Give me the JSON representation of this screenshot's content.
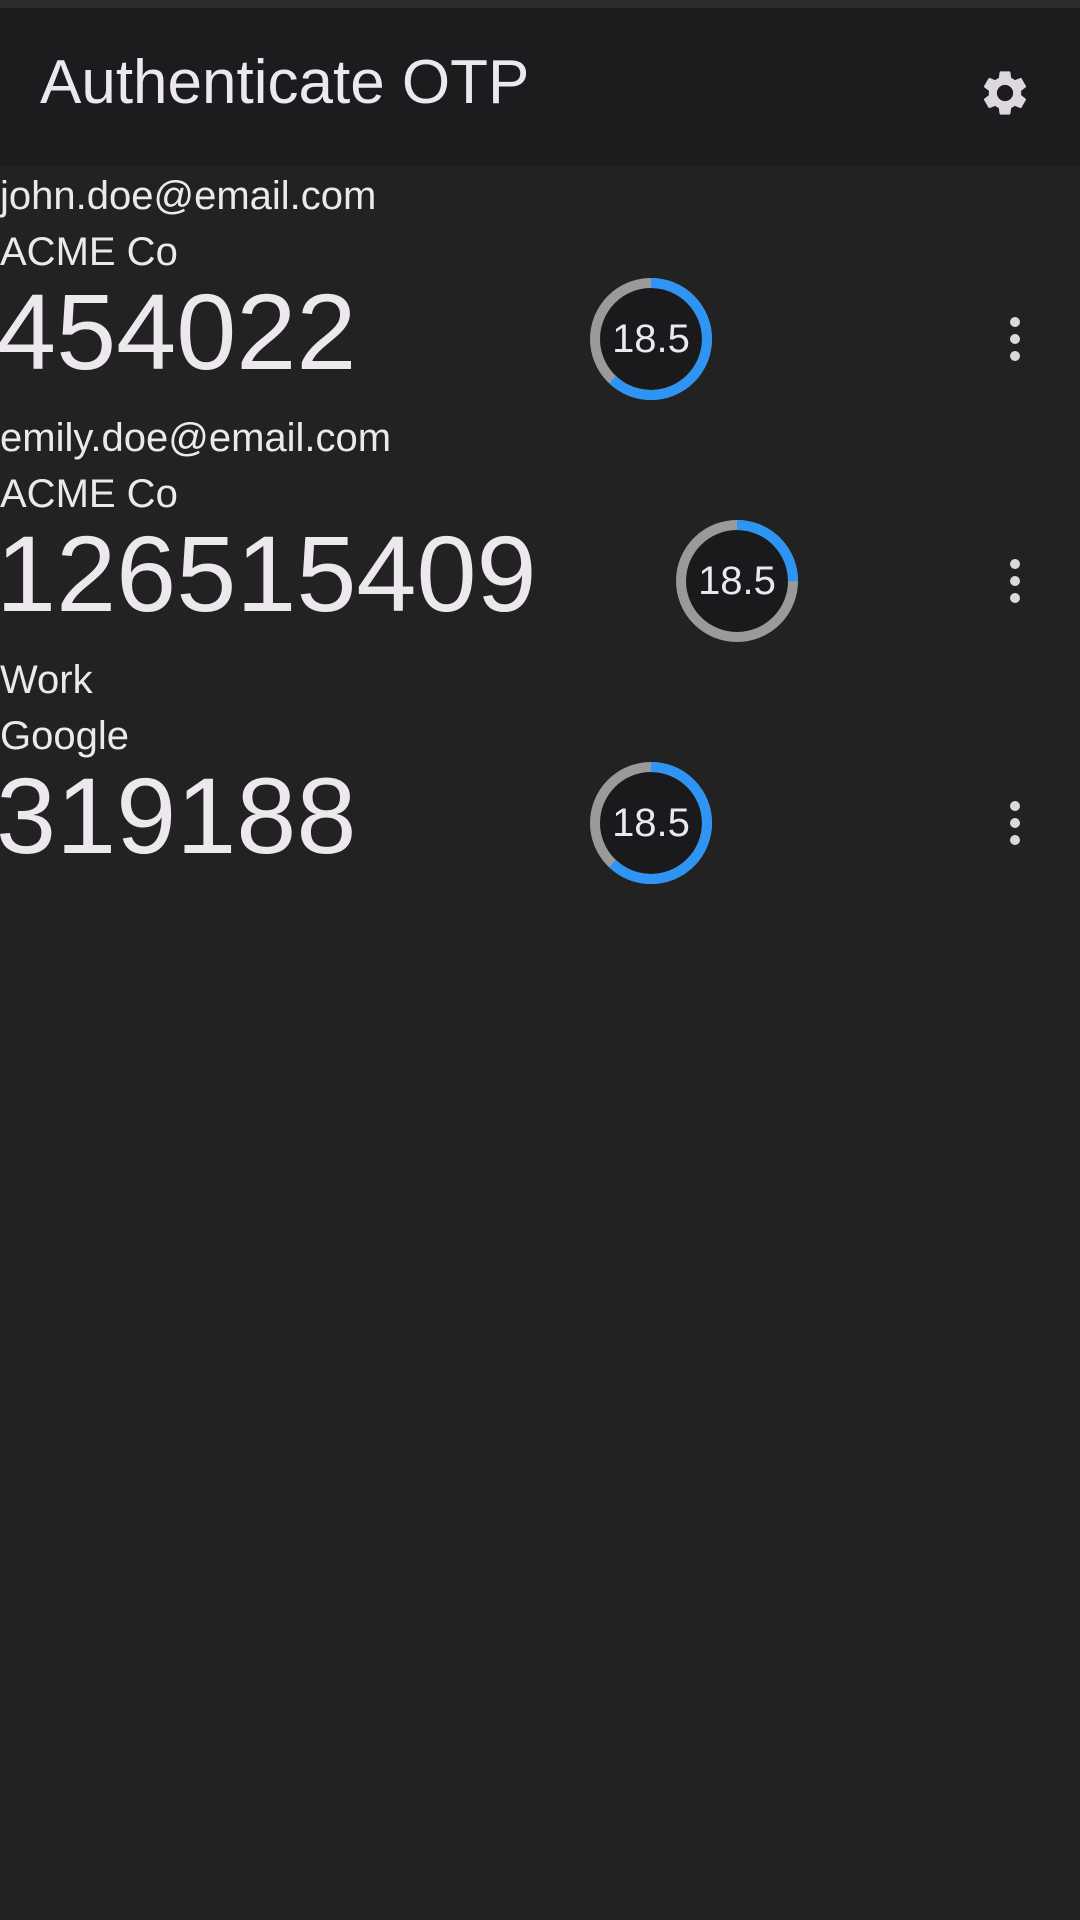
{
  "app_bar": {
    "title": "Authenticate OTP",
    "settings_icon": "gear-icon"
  },
  "accounts": [
    {
      "name": "john.doe@email.com",
      "issuer": "ACME Co",
      "code": "454022",
      "timer": {
        "label": "18.5",
        "remaining_fraction": 0.62
      },
      "menu_icon": "more-vert-icon"
    },
    {
      "name": "emily.doe@email.com",
      "issuer": "ACME Co",
      "code": "126515409",
      "timer": {
        "label": "18.5",
        "remaining_fraction": 0.25
      },
      "menu_icon": "more-vert-icon"
    },
    {
      "name": "Work",
      "issuer": "Google",
      "code": "319188",
      "timer": {
        "label": "18.5",
        "remaining_fraction": 0.62
      },
      "menu_icon": "more-vert-icon"
    }
  ],
  "colors": {
    "background": "#222222",
    "app_bar": "#1c1c1f",
    "text": "#ece8ee",
    "timer_progress": "#2f95f4",
    "timer_track": "#9a9a9a",
    "timer_fill": "#1a1a1c"
  }
}
